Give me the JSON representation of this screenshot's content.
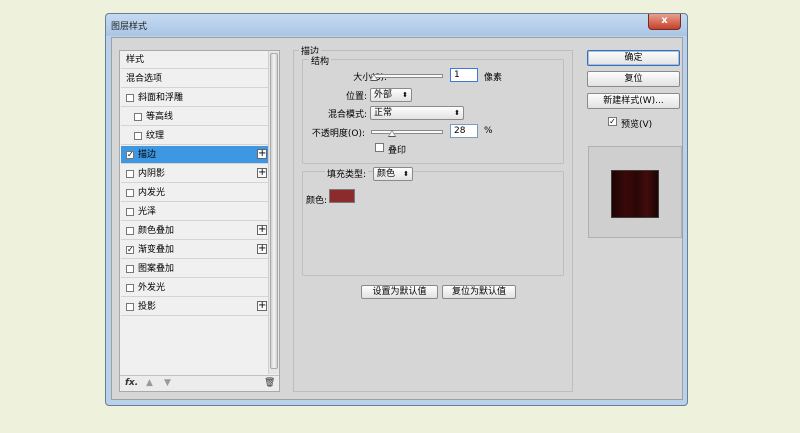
{
  "window": {
    "title": "图层样式",
    "close": "x"
  },
  "sidebar": {
    "items": [
      {
        "label": "样式"
      },
      {
        "label": "混合选项"
      },
      {
        "label": "斜面和浮雕",
        "check": ""
      },
      {
        "label": "等高线",
        "check": ""
      },
      {
        "label": "纹理",
        "check": ""
      },
      {
        "label": "描边",
        "check": "✓",
        "plus": "+"
      },
      {
        "label": "内阴影",
        "check": "",
        "plus": "+"
      },
      {
        "label": "内发光",
        "check": ""
      },
      {
        "label": "光泽",
        "check": ""
      },
      {
        "label": "颜色叠加",
        "check": "",
        "plus": "+"
      },
      {
        "label": "渐变叠加",
        "check": "✓",
        "plus": "+"
      },
      {
        "label": "图案叠加",
        "check": ""
      },
      {
        "label": "外发光",
        "check": ""
      },
      {
        "label": "投影",
        "check": "",
        "plus": "+"
      }
    ],
    "footer": {
      "fx": "fx.",
      "up": "▲",
      "down": "▼",
      "trash": "🗑"
    }
  },
  "stroke": {
    "section_title": "描边",
    "structure_title": "结构",
    "size_label": "大小(S):",
    "size_value": "1",
    "size_unit": "像素",
    "position_label": "位置:",
    "position_value": "外部",
    "blend_label": "混合模式:",
    "blend_value": "正常",
    "opacity_label": "不透明度(O):",
    "opacity_value": "28",
    "opacity_unit": "%",
    "overprint_label": "叠印",
    "fill_type_label": "填充类型:",
    "fill_type_value": "颜色",
    "color_label": "颜色:",
    "color_value": "#8c2b2b",
    "make_default": "设置为默认值",
    "reset_default": "复位为默认值"
  },
  "right": {
    "ok": "确定",
    "reset": "复位",
    "new_style": "新建样式(W)...",
    "preview_label": "预览(V)",
    "preview_check": "✓"
  }
}
